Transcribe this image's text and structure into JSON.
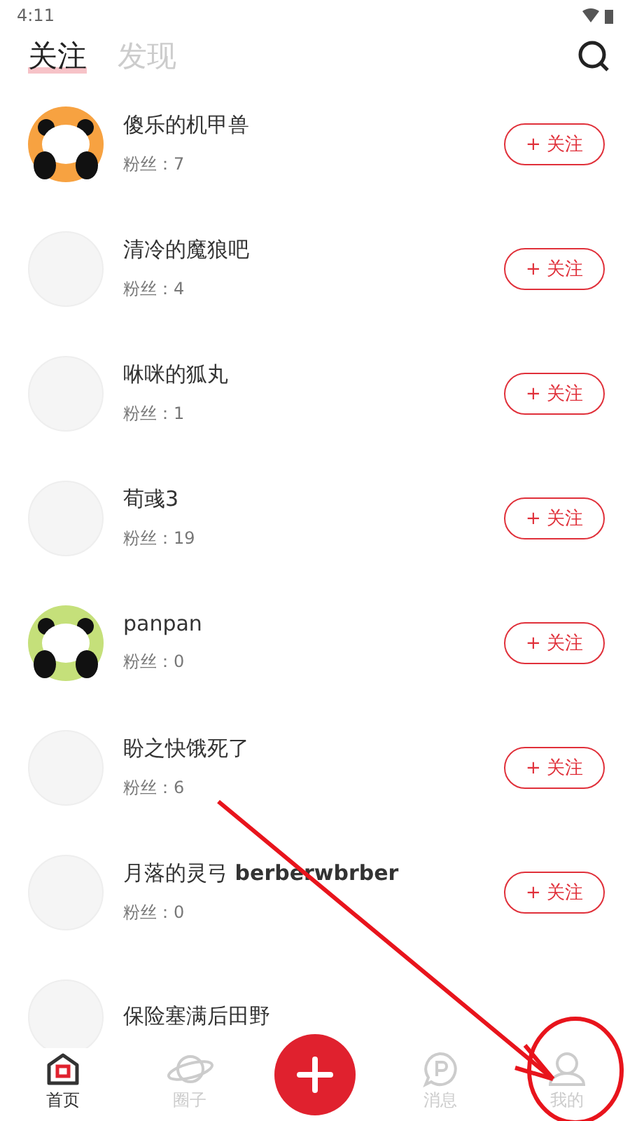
{
  "status_bar": {
    "time": "4:11"
  },
  "tabs": [
    {
      "label": "关注",
      "selected": true
    },
    {
      "label": "发现",
      "selected": false
    }
  ],
  "users": [
    {
      "name": "傻乐的机甲兽",
      "fans": "粉丝：7",
      "kind": "panda",
      "color": "#f7a241",
      "button": "+ 关注"
    },
    {
      "name": "清冷的魔狼吧",
      "fans": "粉丝：4",
      "button": "+ 关注"
    },
    {
      "name": "咻咪的狐丸",
      "fans": "粉丝：1",
      "button": "+ 关注"
    },
    {
      "name": "荀彧3",
      "fans": "粉丝：19",
      "button": "+ 关注"
    },
    {
      "name": "panpan",
      "fans": "粉丝：0",
      "kind": "panda",
      "color": "#c5e07a",
      "button": "+ 关注"
    },
    {
      "name": "盼之快饿死了",
      "fans": "粉丝：6",
      "button": "+ 关注"
    },
    {
      "name": "月落的灵弓 **berberwbrber**",
      "fans": "粉丝：0",
      "button": "+ 关注"
    },
    {
      "name": "保险塞满后田野"
    }
  ],
  "nav": [
    {
      "label": "首页",
      "selected": true
    },
    {
      "label": "圈子",
      "selected": false
    },
    {
      "kind": "add"
    },
    {
      "label": "消息",
      "selected": false
    },
    {
      "label": "我的",
      "selected": false
    }
  ],
  "annotation": {
    "kind": "arrow-circle"
  }
}
